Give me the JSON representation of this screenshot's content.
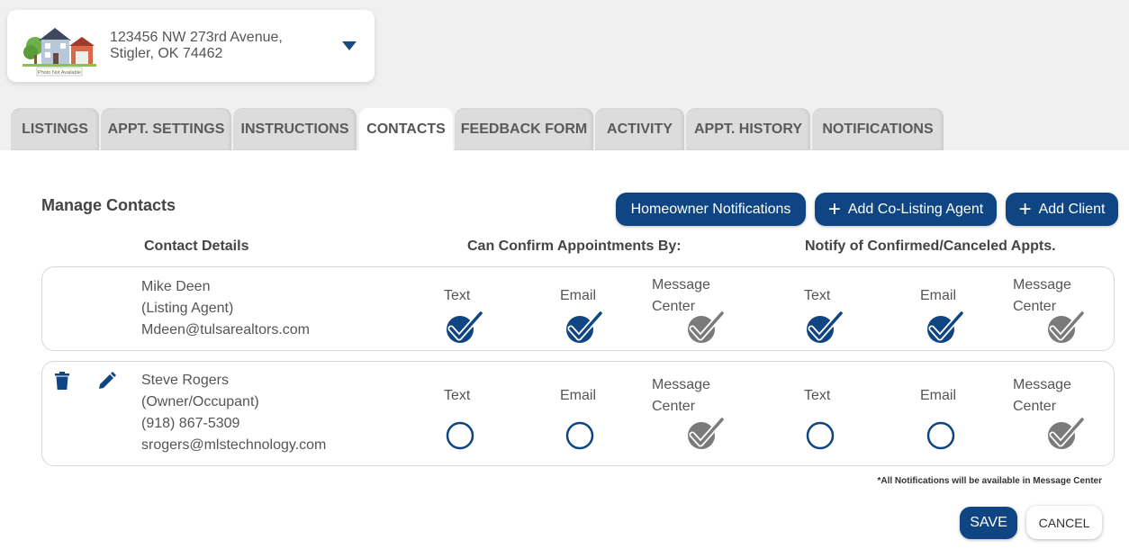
{
  "property": {
    "address_line1": "123456 NW 273rd Avenue,",
    "address_line2": "Stigler, OK 74462",
    "thumb_caption": "Photo Not Available"
  },
  "tabs": [
    {
      "label": "LISTINGS"
    },
    {
      "label": "APPT. SETTINGS"
    },
    {
      "label": "INSTRUCTIONS"
    },
    {
      "label": "CONTACTS",
      "active": true
    },
    {
      "label": "FEEDBACK FORM"
    },
    {
      "label": "ACTIVITY"
    },
    {
      "label": "APPT. HISTORY"
    },
    {
      "label": "NOTIFICATIONS"
    }
  ],
  "main": {
    "title": "Manage Contacts",
    "buttons": {
      "homeowner": "Homeowner Notifications",
      "add_colisting": "Add Co-Listing Agent",
      "add_client": "Add Client"
    },
    "columns": {
      "contact_details": "Contact Details",
      "confirm_by": "Can Confirm Appointments By:",
      "notify": "Notify of Confirmed/Canceled Appts."
    },
    "option_labels": {
      "text": "Text",
      "email": "Email",
      "msg1": "Message",
      "msg2": "Center"
    },
    "contacts": [
      {
        "lines": [
          "Mike Deen",
          "(Listing Agent)",
          "Mdeen@tulsarealtors.com"
        ],
        "confirm": {
          "text": "checked",
          "email": "checked",
          "message_center": "locked"
        },
        "notify": {
          "text": "checked",
          "email": "checked",
          "message_center": "locked"
        }
      },
      {
        "lines": [
          "Steve Rogers",
          "(Owner/Occupant)",
          "(918) 867-5309",
          "srogers@mlstechnology.com"
        ],
        "confirm": {
          "text": "unchecked",
          "email": "unchecked",
          "message_center": "locked"
        },
        "notify": {
          "text": "unchecked",
          "email": "unchecked",
          "message_center": "locked"
        }
      }
    ],
    "footnote": "*All Notifications will be available in Message Center",
    "save_label": "SAVE",
    "cancel_label": "CANCEL"
  },
  "colors": {
    "accent": "#0f4583",
    "locked_check": "#7a7a7a",
    "tab_inactive": "#dcdcdc"
  }
}
